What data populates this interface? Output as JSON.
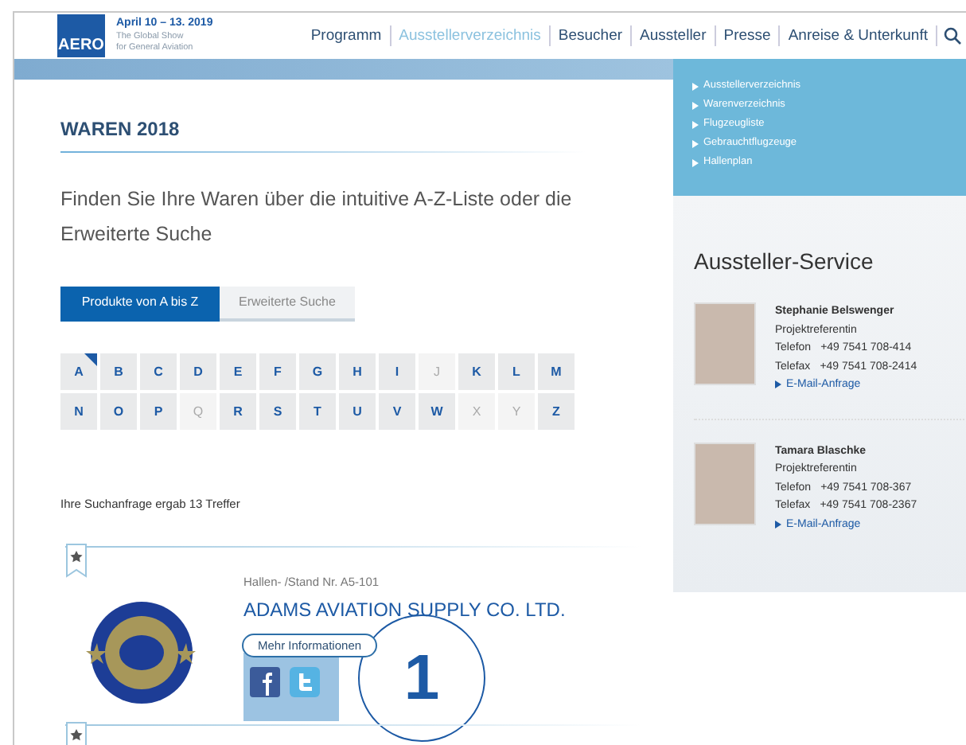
{
  "header": {
    "logo": "AERO",
    "date": "April 10 – 13. 2019",
    "tagline": [
      "The Global Show",
      "for General Aviation"
    ],
    "nav": [
      {
        "label": "Programm",
        "selected": false
      },
      {
        "label": "Ausstellerverzeichnis",
        "selected": true
      },
      {
        "label": "Besucher",
        "selected": false
      },
      {
        "label": "Aussteller",
        "selected": false
      },
      {
        "label": "Presse",
        "selected": false
      },
      {
        "label": "Anreise & Unterkunft",
        "selected": false
      }
    ]
  },
  "main": {
    "title": "WAREN 2018",
    "intro": "Finden Sie Ihre Waren über die intuitive A-Z-Liste oder die Erweiterte Suche",
    "tabs": [
      {
        "label": "Produkte von A bis Z",
        "selected": true
      },
      {
        "label": "Erweiterte Suche",
        "selected": false
      }
    ],
    "letters": [
      {
        "label": "A",
        "selected": true,
        "disabled": false
      },
      {
        "label": "B",
        "selected": false,
        "disabled": false
      },
      {
        "label": "C",
        "selected": false,
        "disabled": false
      },
      {
        "label": "D",
        "selected": false,
        "disabled": false
      },
      {
        "label": "E",
        "selected": false,
        "disabled": false
      },
      {
        "label": "F",
        "selected": false,
        "disabled": false
      },
      {
        "label": "G",
        "selected": false,
        "disabled": false
      },
      {
        "label": "H",
        "selected": false,
        "disabled": false
      },
      {
        "label": "I",
        "selected": false,
        "disabled": false
      },
      {
        "label": "J",
        "selected": false,
        "disabled": true
      },
      {
        "label": "K",
        "selected": false,
        "disabled": false
      },
      {
        "label": "L",
        "selected": false,
        "disabled": false
      },
      {
        "label": "M",
        "selected": false,
        "disabled": false
      },
      {
        "label": "N",
        "selected": false,
        "disabled": false
      },
      {
        "label": "O",
        "selected": false,
        "disabled": false
      },
      {
        "label": "P",
        "selected": false,
        "disabled": false
      },
      {
        "label": "Q",
        "selected": false,
        "disabled": true
      },
      {
        "label": "R",
        "selected": false,
        "disabled": false
      },
      {
        "label": "S",
        "selected": false,
        "disabled": false
      },
      {
        "label": "T",
        "selected": false,
        "disabled": false
      },
      {
        "label": "U",
        "selected": false,
        "disabled": false
      },
      {
        "label": "V",
        "selected": false,
        "disabled": false
      },
      {
        "label": "W",
        "selected": false,
        "disabled": false
      },
      {
        "label": "X",
        "selected": false,
        "disabled": true
      },
      {
        "label": "Y",
        "selected": false,
        "disabled": true
      },
      {
        "label": "Z",
        "selected": false,
        "disabled": false
      }
    ],
    "result_count": "Ihre Suchanfrage ergab 13 Treffer",
    "results": [
      {
        "stand": "Hallen- /Stand Nr. A5-101",
        "company": "ADAMS AVIATION SUPPLY CO. LTD.",
        "button": "Mehr Informationen",
        "annotation": "1"
      }
    ]
  },
  "sidebar": {
    "links": [
      "Ausstellerverzeichnis",
      "Warenverzeichnis",
      "Flugzeugliste",
      "Gebrauchtflugzeuge",
      "Hallenplan"
    ],
    "service_title": "Aussteller-Service",
    "contacts": [
      {
        "name": "Stephanie Belswenger",
        "role": "Projektreferentin",
        "phone_label": "Telefon",
        "phone": "+49 7541 708-414",
        "fax_label": "Telefax",
        "fax": "+49 7541 708-2414",
        "email": "E-Mail-Anfrage"
      },
      {
        "name": "Tamara Blaschke",
        "role": "Projektreferentin",
        "phone_label": "Telefon",
        "phone": "+49 7541 708-367",
        "fax_label": "Telefax",
        "fax": "+49 7541 708-2367",
        "email": "E-Mail-Anfrage"
      }
    ]
  }
}
